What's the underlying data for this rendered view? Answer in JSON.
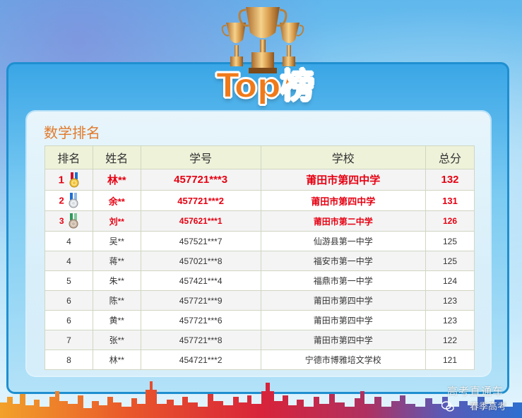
{
  "title": "Top榜",
  "panel_title": "数学排名",
  "table": {
    "headers": [
      "排名",
      "姓名",
      "学号",
      "学校",
      "总分"
    ],
    "rows": [
      {
        "rank": "1",
        "name": "林**",
        "id": "457721***3",
        "school": "莆田市第四中学",
        "score": "132",
        "medal": "gold"
      },
      {
        "rank": "2",
        "name": "余**",
        "id": "457721***2",
        "school": "莆田市第四中学",
        "score": "131",
        "medal": "silver"
      },
      {
        "rank": "3",
        "name": "刘**",
        "id": "457621***1",
        "school": "莆田市第二中学",
        "score": "126",
        "medal": "bronze"
      },
      {
        "rank": "4",
        "name": "吴**",
        "id": "457521***7",
        "school": "仙游县第一中学",
        "score": "125"
      },
      {
        "rank": "4",
        "name": "蒋**",
        "id": "457021***8",
        "school": "福安市第一中学",
        "score": "125"
      },
      {
        "rank": "5",
        "name": "朱**",
        "id": "457421***4",
        "school": "福鼎市第一中学",
        "score": "124"
      },
      {
        "rank": "6",
        "name": "陈**",
        "id": "457721***9",
        "school": "莆田市第四中学",
        "score": "123"
      },
      {
        "rank": "6",
        "name": "黄**",
        "id": "457721***6",
        "school": "莆田市第四中学",
        "score": "123"
      },
      {
        "rank": "7",
        "name": "张**",
        "id": "457721***8",
        "school": "莆田市第四中学",
        "score": "122"
      },
      {
        "rank": "8",
        "name": "林**",
        "id": "454721***2",
        "school": "宁德市博雅培文学校",
        "score": "121"
      }
    ]
  },
  "watermark": {
    "line1": "高考直通车",
    "line2": "春季高考"
  },
  "colors": {
    "accent_red": "#e60012",
    "title_orange": "#f07a1a",
    "panel_title": "#e27a2b",
    "frame_blue": "#1f8fd0"
  },
  "icons": [
    "trophy-icon",
    "gold-medal-icon",
    "silver-medal-icon",
    "bronze-medal-icon",
    "wechat-icon"
  ]
}
